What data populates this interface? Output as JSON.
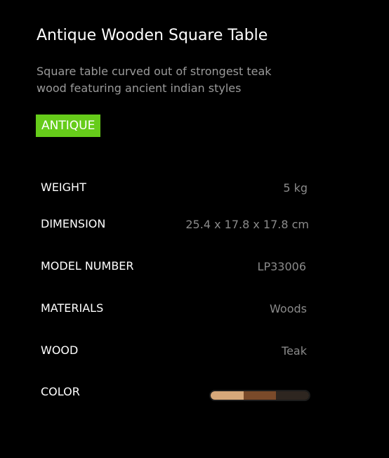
{
  "product": {
    "title": "Antique Wooden Square Table",
    "description": "Square table curved out of strongest teak wood featuring ancient indian styles",
    "badge": "ANTIQUE"
  },
  "specs": {
    "weight": {
      "label": "WEIGHT",
      "value": "5 kg"
    },
    "dimension": {
      "label": "DIMENSION",
      "value": "25.4 x 17.8 x 17.8 cm"
    },
    "model_number": {
      "label": "MODEL NUMBER",
      "value": "LP33006"
    },
    "materials": {
      "label": "MATERIALS",
      "value": "Woods"
    },
    "wood": {
      "label": "WOOD",
      "value": "Teak"
    },
    "color": {
      "label": "COLOR",
      "swatches": [
        "#d7a87a",
        "#7a4a2a",
        "#2e2620"
      ]
    }
  },
  "colors": {
    "background": "#000000",
    "badge": "#66cc1a",
    "muted_text": "#9a9a9a"
  }
}
